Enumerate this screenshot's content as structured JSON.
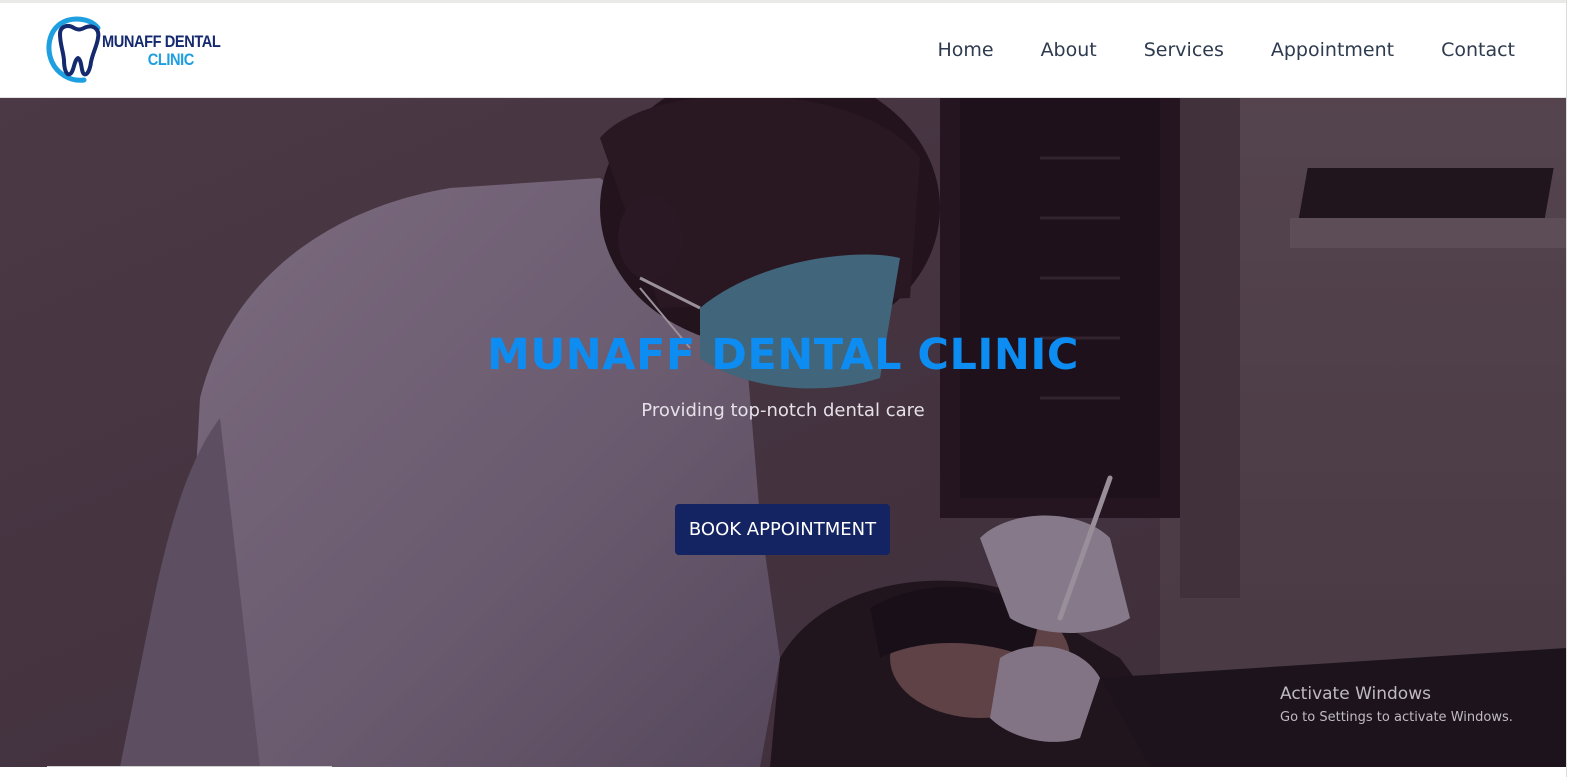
{
  "brand": {
    "line1": "MUNAFF DENTAL",
    "line2": "CLINIC",
    "color_primary": "#152a6e",
    "color_accent": "#1e9fe0"
  },
  "nav": {
    "items": [
      {
        "label": "Home"
      },
      {
        "label": "About"
      },
      {
        "label": "Services"
      },
      {
        "label": "Appointment"
      },
      {
        "label": "Contact"
      }
    ]
  },
  "hero": {
    "title": "MUNAFF DENTAL CLINIC",
    "subtitle": "Providing top-notch dental care",
    "cta_label": "BOOK APPOINTMENT",
    "title_color": "#0d8cf2",
    "cta_color": "#142361"
  },
  "watermark": {
    "title": "Activate Windows",
    "subtitle": "Go to Settings to activate Windows."
  }
}
